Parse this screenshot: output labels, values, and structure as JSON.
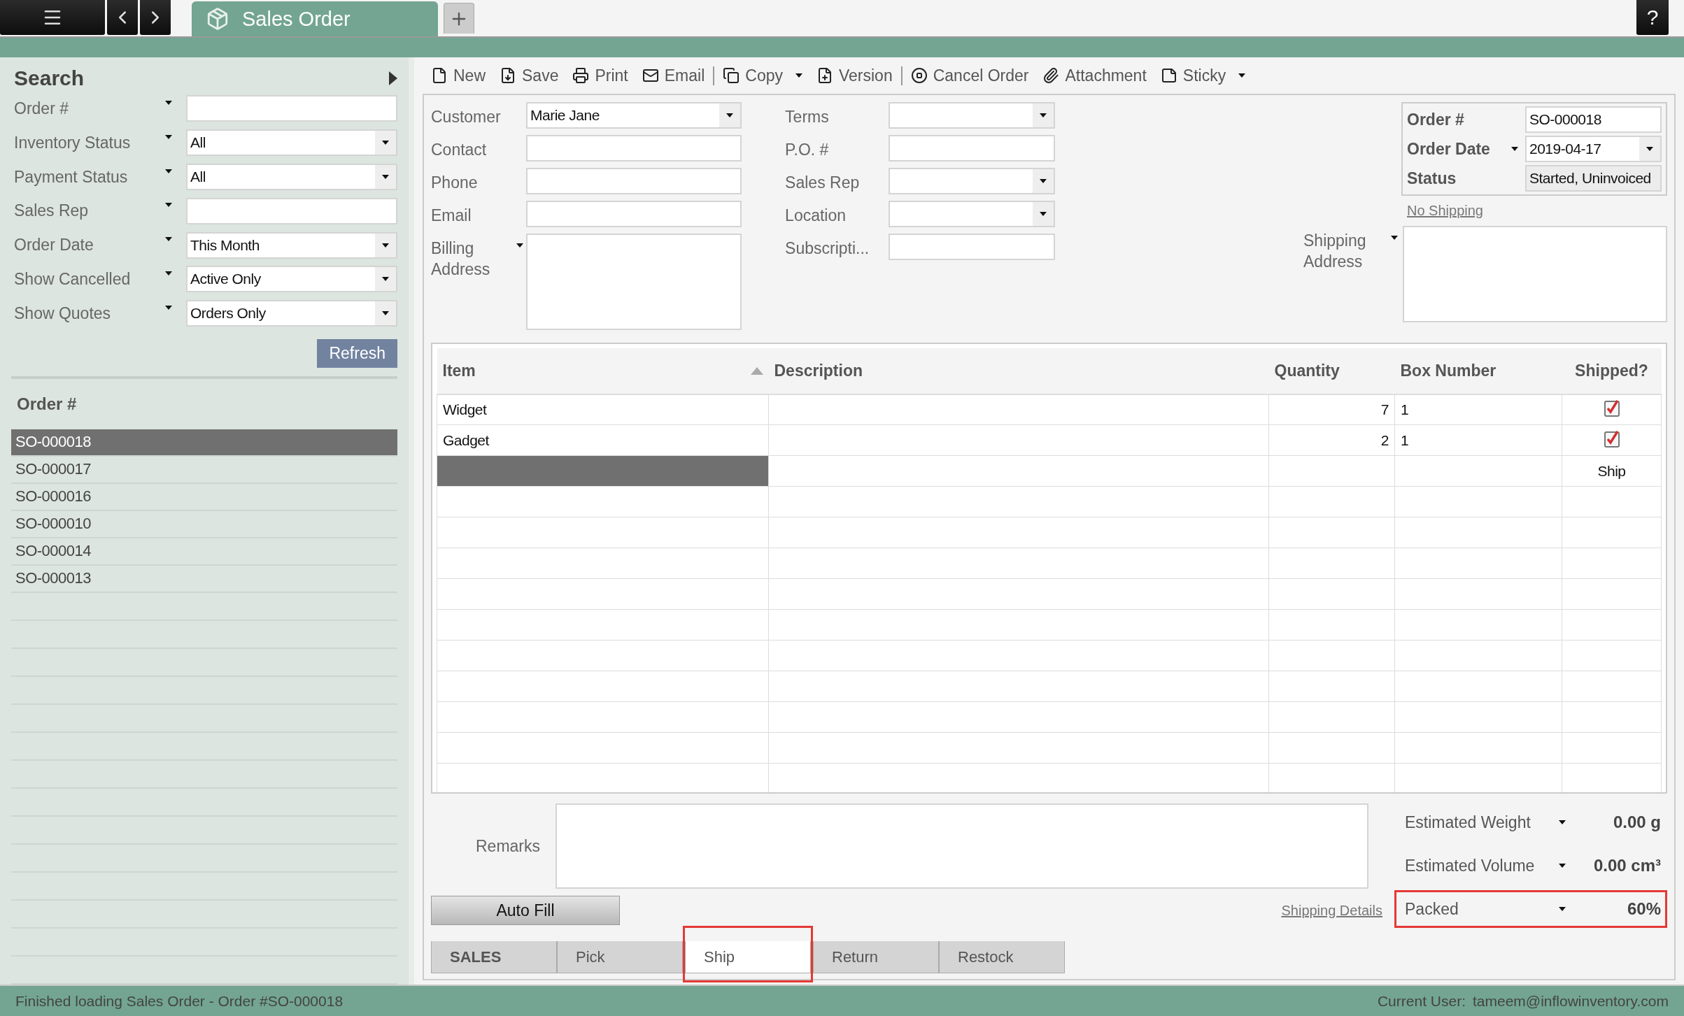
{
  "app": {
    "document_tab": "Sales Order",
    "help_label": "?"
  },
  "sidebar": {
    "title": "Search",
    "filters": [
      {
        "label": "Order #",
        "kind": "text"
      },
      {
        "label": "Inventory Status",
        "kind": "select",
        "value": "All"
      },
      {
        "label": "Payment Status",
        "kind": "select",
        "value": "All"
      },
      {
        "label": "Sales Rep",
        "kind": "text"
      },
      {
        "label": "Order Date",
        "kind": "select",
        "value": "This Month"
      },
      {
        "label": "Show Cancelled",
        "kind": "select",
        "value": "Active Only"
      },
      {
        "label": "Show Quotes",
        "kind": "select",
        "value": "Orders Only"
      }
    ],
    "refresh_button": "Refresh",
    "list_header": "Order #",
    "orders": [
      {
        "number": "SO-000018",
        "selected": true
      },
      {
        "number": "SO-000017",
        "selected": false
      },
      {
        "number": "SO-000016",
        "selected": false
      },
      {
        "number": "SO-000010",
        "selected": false
      },
      {
        "number": "SO-000014",
        "selected": false
      },
      {
        "number": "SO-000013",
        "selected": false
      }
    ]
  },
  "toolbar": {
    "groups": [
      [
        {
          "label": "New",
          "dropdown": false
        },
        {
          "label": "Save",
          "dropdown": false
        },
        {
          "label": "Print",
          "dropdown": false
        },
        {
          "label": "Email",
          "dropdown": false
        }
      ],
      [
        {
          "label": "Copy",
          "dropdown": true
        },
        {
          "label": "Version",
          "dropdown": false
        }
      ],
      [
        {
          "label": "Cancel Order",
          "dropdown": false
        },
        {
          "label": "Attachment",
          "dropdown": false
        },
        {
          "label": "Sticky",
          "dropdown": true
        }
      ]
    ]
  },
  "form": {
    "left": [
      {
        "label": "Customer",
        "kind": "select",
        "value": "Marie Jane"
      },
      {
        "label": "Contact",
        "kind": "text"
      },
      {
        "label": "Phone",
        "kind": "text"
      },
      {
        "label": "Email",
        "kind": "text"
      },
      {
        "label": "Billing Address",
        "kind": "textarea"
      }
    ],
    "middle": [
      {
        "label": "Terms",
        "kind": "select"
      },
      {
        "label": "P.O. #",
        "kind": "text"
      },
      {
        "label": "Sales Rep",
        "kind": "select"
      },
      {
        "label": "Location",
        "kind": "select"
      },
      {
        "label": "Subscripti...",
        "kind": "text"
      }
    ],
    "order_number": {
      "label": "Order #",
      "value": "SO-000018"
    },
    "order_date": {
      "label": "Order Date",
      "value": "2019-04-17"
    },
    "status": {
      "label": "Status",
      "value": "Started, Uninvoiced"
    },
    "shipping_link": "No Shipping",
    "shipping_address": {
      "label": "Shipping Address"
    }
  },
  "table": {
    "columns": [
      {
        "label": "Item",
        "sorted": true
      },
      {
        "label": "Description",
        "sorted": false
      },
      {
        "label": "Quantity",
        "sorted": false
      },
      {
        "label": "Box Number",
        "sorted": false
      },
      {
        "label": "Shipped?",
        "sorted": false
      }
    ],
    "rows": [
      {
        "item": "Widget",
        "quantity": "7",
        "box_number": "1",
        "shipped": true,
        "selected": false
      },
      {
        "item": "Gadget",
        "quantity": "2",
        "box_number": "1",
        "shipped": true,
        "selected": false
      },
      {
        "action": "Ship",
        "selected": true
      }
    ]
  },
  "remarks": {
    "label": "Remarks"
  },
  "auto_fill_button": "Auto Fill",
  "shipping_details_link": "Shipping Details",
  "totals": [
    {
      "label": "Estimated Weight",
      "value": "0.00 g",
      "highlighted": false
    },
    {
      "label": "Estimated Volume",
      "value": "0.00 cm³",
      "highlighted": false
    },
    {
      "label": "Packed",
      "value": "60%",
      "highlighted": true
    }
  ],
  "bottom_tabs": [
    {
      "label": "SALES",
      "kind": "section",
      "selected": false,
      "highlighted": false
    },
    {
      "label": "Pick",
      "kind": "tab",
      "selected": false,
      "highlighted": false
    },
    {
      "label": "Ship",
      "kind": "tab",
      "selected": true,
      "highlighted": true
    },
    {
      "label": "Return",
      "kind": "tab",
      "selected": false,
      "highlighted": false
    },
    {
      "label": "Restock",
      "kind": "tab",
      "selected": false,
      "highlighted": false
    }
  ],
  "status_bar": {
    "message": "Finished loading Sales Order - Order #SO-000018",
    "user_label": "Current User:",
    "user": "tameem@inflowinventory.com"
  }
}
